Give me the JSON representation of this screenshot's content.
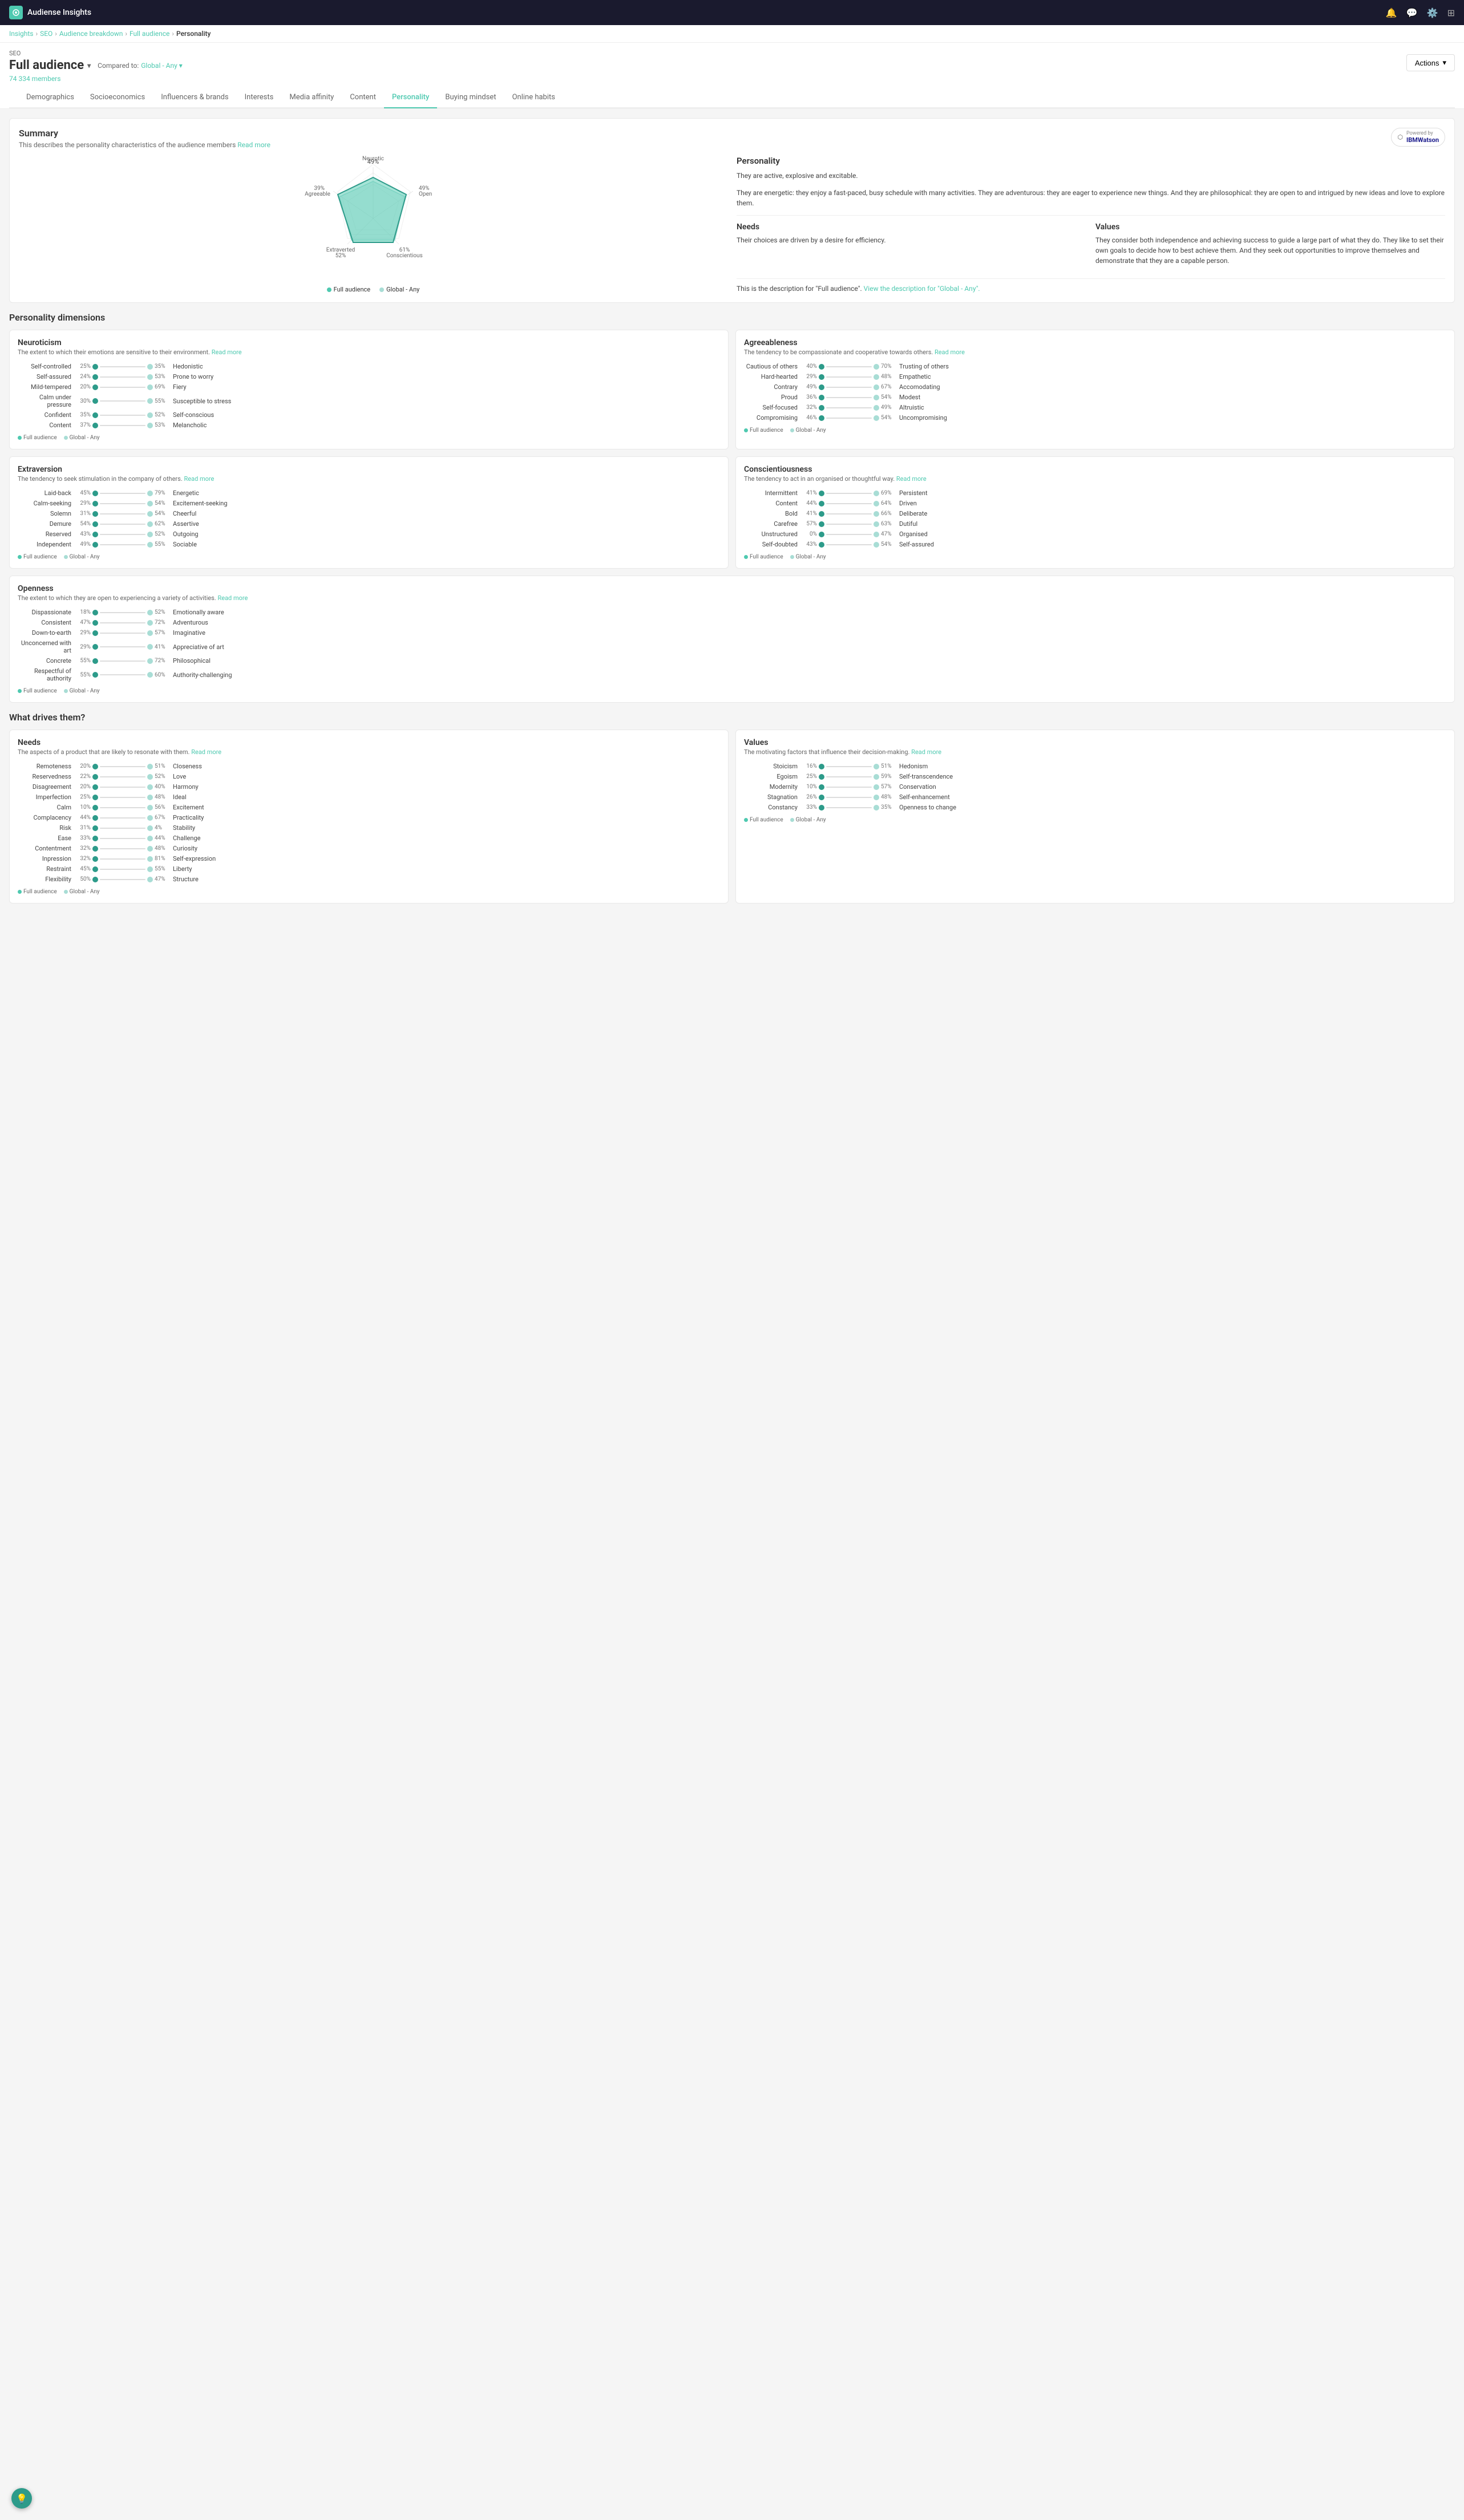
{
  "app": {
    "title": "Audiense Insights",
    "nav_icons": [
      "bell",
      "chat",
      "gear",
      "grid"
    ]
  },
  "breadcrumb": {
    "items": [
      "Insights",
      "SEO",
      "Audience breakdown",
      "Full audience",
      "Personality"
    ],
    "links": [
      true,
      true,
      true,
      true,
      false
    ]
  },
  "header": {
    "label": "SEO",
    "audience": "Full audience",
    "compared_to": "Compared to:",
    "global_label": "Global - Any",
    "member_count": "74 334 members",
    "actions_label": "Actions"
  },
  "tabs": {
    "items": [
      "Demographics",
      "Socioeconomics",
      "Influencers & brands",
      "Interests",
      "Media affinity",
      "Content",
      "Personality",
      "Buying mindset",
      "Online habits"
    ],
    "active": 6
  },
  "summary": {
    "title": "Summary",
    "description": "This describes the personality characteristics of the audience members",
    "read_more": "Read more",
    "powered_by": "Powered by",
    "watson_label": "IBMWatson",
    "radar": {
      "labels": [
        "Neurotic",
        "Open",
        "Conscientious",
        "Extraverted",
        "Agreeable"
      ],
      "full_values": [
        49,
        49,
        61,
        52,
        39
      ],
      "global_values": [
        45,
        45,
        55,
        48,
        42
      ]
    },
    "personality": {
      "title": "Personality",
      "text1": "They are active, explosive and excitable.",
      "text2": "They are energetic: they enjoy a fast-paced, busy schedule with many activities. They are adventurous: they are eager to experience new things. And they are philosophical: they are open to and intrigued by new ideas and love to explore them."
    },
    "needs": {
      "title": "Needs",
      "text": "Their choices are driven by a desire for efficiency."
    },
    "values": {
      "title": "Values",
      "text": "They consider both independence and achieving success to guide a large part of what they do. They like to set their own goals to decide how to best achieve them. And they seek out opportunities to improve themselves and demonstrate that they are a capable person."
    },
    "note": "This is the description for \"Full audience\".",
    "note_link": "View the description for \"Global - Any\".",
    "legend": {
      "full": "Full audience",
      "global": "Global - Any"
    }
  },
  "personality_dimensions": {
    "title": "Personality dimensions",
    "sections": [
      {
        "title": "Neuroticism",
        "desc": "The extent to which their emotions are sensitive to their environment.",
        "read_more": "Read more",
        "traits": [
          {
            "left": "Self-controlled",
            "left_pct": "25%",
            "right_pct": "35%",
            "right": "Hedonistic"
          },
          {
            "left": "Self-assured",
            "left_pct": "24%",
            "right_pct": "53%",
            "right": "Prone to worry"
          },
          {
            "left": "Mild-tempered",
            "left_pct": "20%",
            "right_pct": "69%",
            "right": "Fiery"
          },
          {
            "left": "Calm under pressure",
            "left_pct": "30%",
            "right_pct": "55%",
            "right": "Susceptible to stress"
          },
          {
            "left": "Confident",
            "left_pct": "35%",
            "right_pct": "52%",
            "right": "Self-conscious"
          },
          {
            "left": "Content",
            "left_pct": "37%",
            "right_pct": "53%",
            "right": "Melancholic"
          }
        ]
      },
      {
        "title": "Agreeableness",
        "desc": "The tendency to be compassionate and cooperative towards others.",
        "read_more": "Read more",
        "traits": [
          {
            "left": "Cautious of others",
            "left_pct": "40%",
            "right_pct": "70%",
            "right": "Trusting of others"
          },
          {
            "left": "Hard-hearted",
            "left_pct": "29%",
            "right_pct": "48%",
            "right": "Empathetic"
          },
          {
            "left": "Contrary",
            "left_pct": "49%",
            "right_pct": "67%",
            "right": "Accomodating"
          },
          {
            "left": "Proud",
            "left_pct": "36%",
            "right_pct": "54%",
            "right": "Modest"
          },
          {
            "left": "Self-focused",
            "left_pct": "32%",
            "right_pct": "49%",
            "right": "Altruistic"
          },
          {
            "left": "Compromising",
            "left_pct": "46%",
            "right_pct": "54%",
            "right": "Uncompromising"
          }
        ]
      },
      {
        "title": "Extraversion",
        "desc": "The tendency to seek stimulation in the company of others.",
        "read_more": "Read more",
        "traits": [
          {
            "left": "Laid-back",
            "left_pct": "45%",
            "right_pct": "79%",
            "right": "Energetic"
          },
          {
            "left": "Calm-seeking",
            "left_pct": "29%",
            "right_pct": "54%",
            "right": "Excitement-seeking"
          },
          {
            "left": "Solemn",
            "left_pct": "31%",
            "right_pct": "54%",
            "right": "Cheerful"
          },
          {
            "left": "Demure",
            "left_pct": "54%",
            "right_pct": "62%",
            "right": "Assertive"
          },
          {
            "left": "Reserved",
            "left_pct": "43%",
            "right_pct": "52%",
            "right": "Outgoing"
          },
          {
            "left": "Independent",
            "left_pct": "49%",
            "right_pct": "55%",
            "right": "Sociable"
          }
        ]
      },
      {
        "title": "Conscientiousness",
        "desc": "The tendency to act in an organised or thoughtful way.",
        "read_more": "Read more",
        "traits": [
          {
            "left": "Intermittent",
            "left_pct": "41%",
            "right_pct": "69%",
            "right": "Persistent"
          },
          {
            "left": "Content",
            "left_pct": "44%",
            "right_pct": "64%",
            "right": "Driven"
          },
          {
            "left": "Bold",
            "left_pct": "41%",
            "right_pct": "66%",
            "right": "Deliberate"
          },
          {
            "left": "Carefree",
            "left_pct": "57%",
            "right_pct": "63%",
            "right": "Dutiful"
          },
          {
            "left": "Unstructured",
            "left_pct": "0%",
            "right_pct": "47%",
            "right": "Organised"
          },
          {
            "left": "Self-doubted",
            "left_pct": "43%",
            "right_pct": "54%",
            "right": "Self-assured"
          }
        ]
      },
      {
        "title": "Openness",
        "desc": "The extent to which they are open to experiencing a variety of activities.",
        "read_more": "Read more",
        "is_full": true,
        "traits": [
          {
            "left": "Dispassionate",
            "left_pct": "18%",
            "right_pct": "52%",
            "right": "Emotionally aware"
          },
          {
            "left": "Consistent",
            "left_pct": "47%",
            "right_pct": "72%",
            "right": "Adventurous"
          },
          {
            "left": "Down-to-earth",
            "left_pct": "29%",
            "right_pct": "57%",
            "right": "Imaginative"
          },
          {
            "left": "Unconcerned with art",
            "left_pct": "29%",
            "right_pct": "41%",
            "right": "Appreciative of art"
          },
          {
            "left": "Concrete",
            "left_pct": "55%",
            "right_pct": "72%",
            "right": "Philosophical"
          },
          {
            "left": "Respectful of authority",
            "left_pct": "55%",
            "right_pct": "60%",
            "right": "Authority-challenging"
          }
        ]
      }
    ],
    "legend": {
      "full": "Full audience",
      "global": "Global - Any"
    }
  },
  "what_drives": {
    "title": "What drives them?",
    "needs": {
      "title": "Needs",
      "desc": "The aspects of a product that are likely to resonate with them.",
      "read_more": "Read more",
      "traits": [
        {
          "left": "Remoteness",
          "left_pct": "20%",
          "right_pct": "51%",
          "right": "Closeness"
        },
        {
          "left": "Reservedness",
          "left_pct": "22%",
          "right_pct": "52%",
          "right": "Love"
        },
        {
          "left": "Disagreement",
          "left_pct": "20%",
          "right_pct": "40%",
          "right": "Harmony"
        },
        {
          "left": "Imperfection",
          "left_pct": "25%",
          "right_pct": "48%",
          "right": "Ideal"
        },
        {
          "left": "Calm",
          "left_pct": "10%",
          "right_pct": "56%",
          "right": "Excitement"
        },
        {
          "left": "Complacency",
          "left_pct": "44%",
          "right_pct": "67%",
          "right": "Practicality"
        },
        {
          "left": "Risk",
          "left_pct": "31%",
          "right_pct": "4%",
          "right": "Stability"
        },
        {
          "left": "Ease",
          "left_pct": "33%",
          "right_pct": "44%",
          "right": "Challenge"
        },
        {
          "left": "Contentment",
          "left_pct": "32%",
          "right_pct": "48%",
          "right": "Curiosity"
        },
        {
          "left": "Inpression",
          "left_pct": "32%",
          "right_pct": "81%",
          "right": "Self-expression"
        },
        {
          "left": "Restraint",
          "left_pct": "45%",
          "right_pct": "55%",
          "right": "Liberty"
        },
        {
          "left": "Flexibility",
          "left_pct": "50%",
          "right_pct": "47%",
          "right": "Structure"
        }
      ]
    },
    "values": {
      "title": "Values",
      "desc": "The motivating factors that influence their decision-making.",
      "read_more": "Read more",
      "traits": [
        {
          "left": "Stoicism",
          "left_pct": "16%",
          "right_pct": "51%",
          "right": "Hedonism"
        },
        {
          "left": "Egoism",
          "left_pct": "25%",
          "right_pct": "59%",
          "right": "Self-transcendence"
        },
        {
          "left": "Modernity",
          "left_pct": "10%",
          "right_pct": "57%",
          "right": "Conservation"
        },
        {
          "left": "Stagnation",
          "left_pct": "26%",
          "right_pct": "48%",
          "right": "Self-enhancement"
        },
        {
          "left": "Constancy",
          "left_pct": "33%",
          "right_pct": "35%",
          "right": "Openness to change"
        }
      ],
      "legend": {
        "full": "Full audience",
        "global": "Global - Any"
      }
    }
  }
}
